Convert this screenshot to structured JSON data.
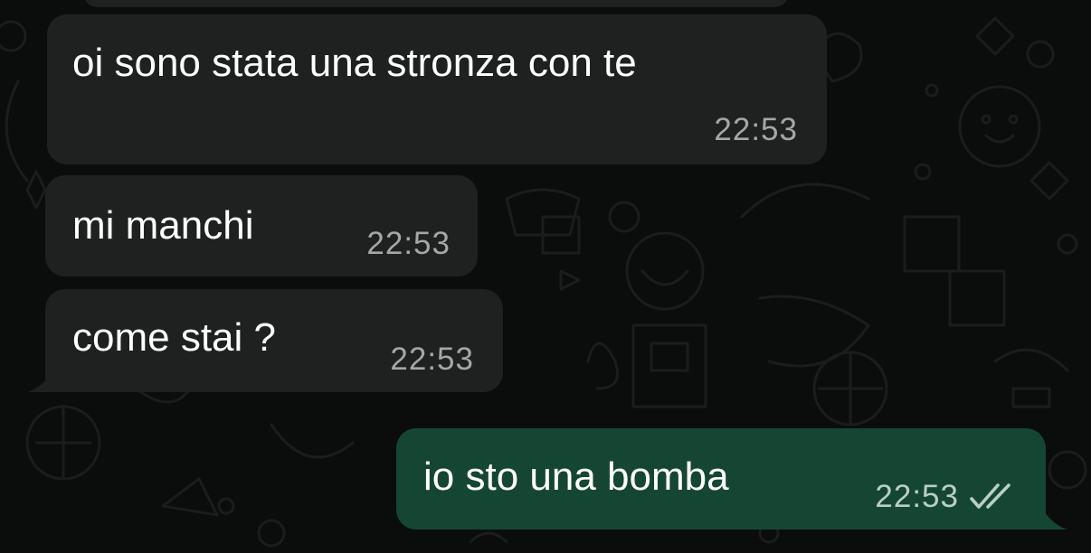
{
  "chat": {
    "messages": [
      {
        "direction": "incoming",
        "text": "oi sono stata una stronza con te",
        "time": "22:53"
      },
      {
        "direction": "incoming",
        "text": "mi manchi",
        "time": "22:53"
      },
      {
        "direction": "incoming",
        "text": "come stai ?",
        "time": "22:53"
      },
      {
        "direction": "outgoing",
        "text": "io sto una bomba",
        "time": "22:53",
        "status_icon": "double-check-icon"
      }
    ]
  },
  "colors": {
    "background": "#0b0c0c",
    "incoming_bubble": "#1f2121",
    "outgoing_bubble": "#154634",
    "text": "#ffffff",
    "time": "#a3a8a6"
  }
}
